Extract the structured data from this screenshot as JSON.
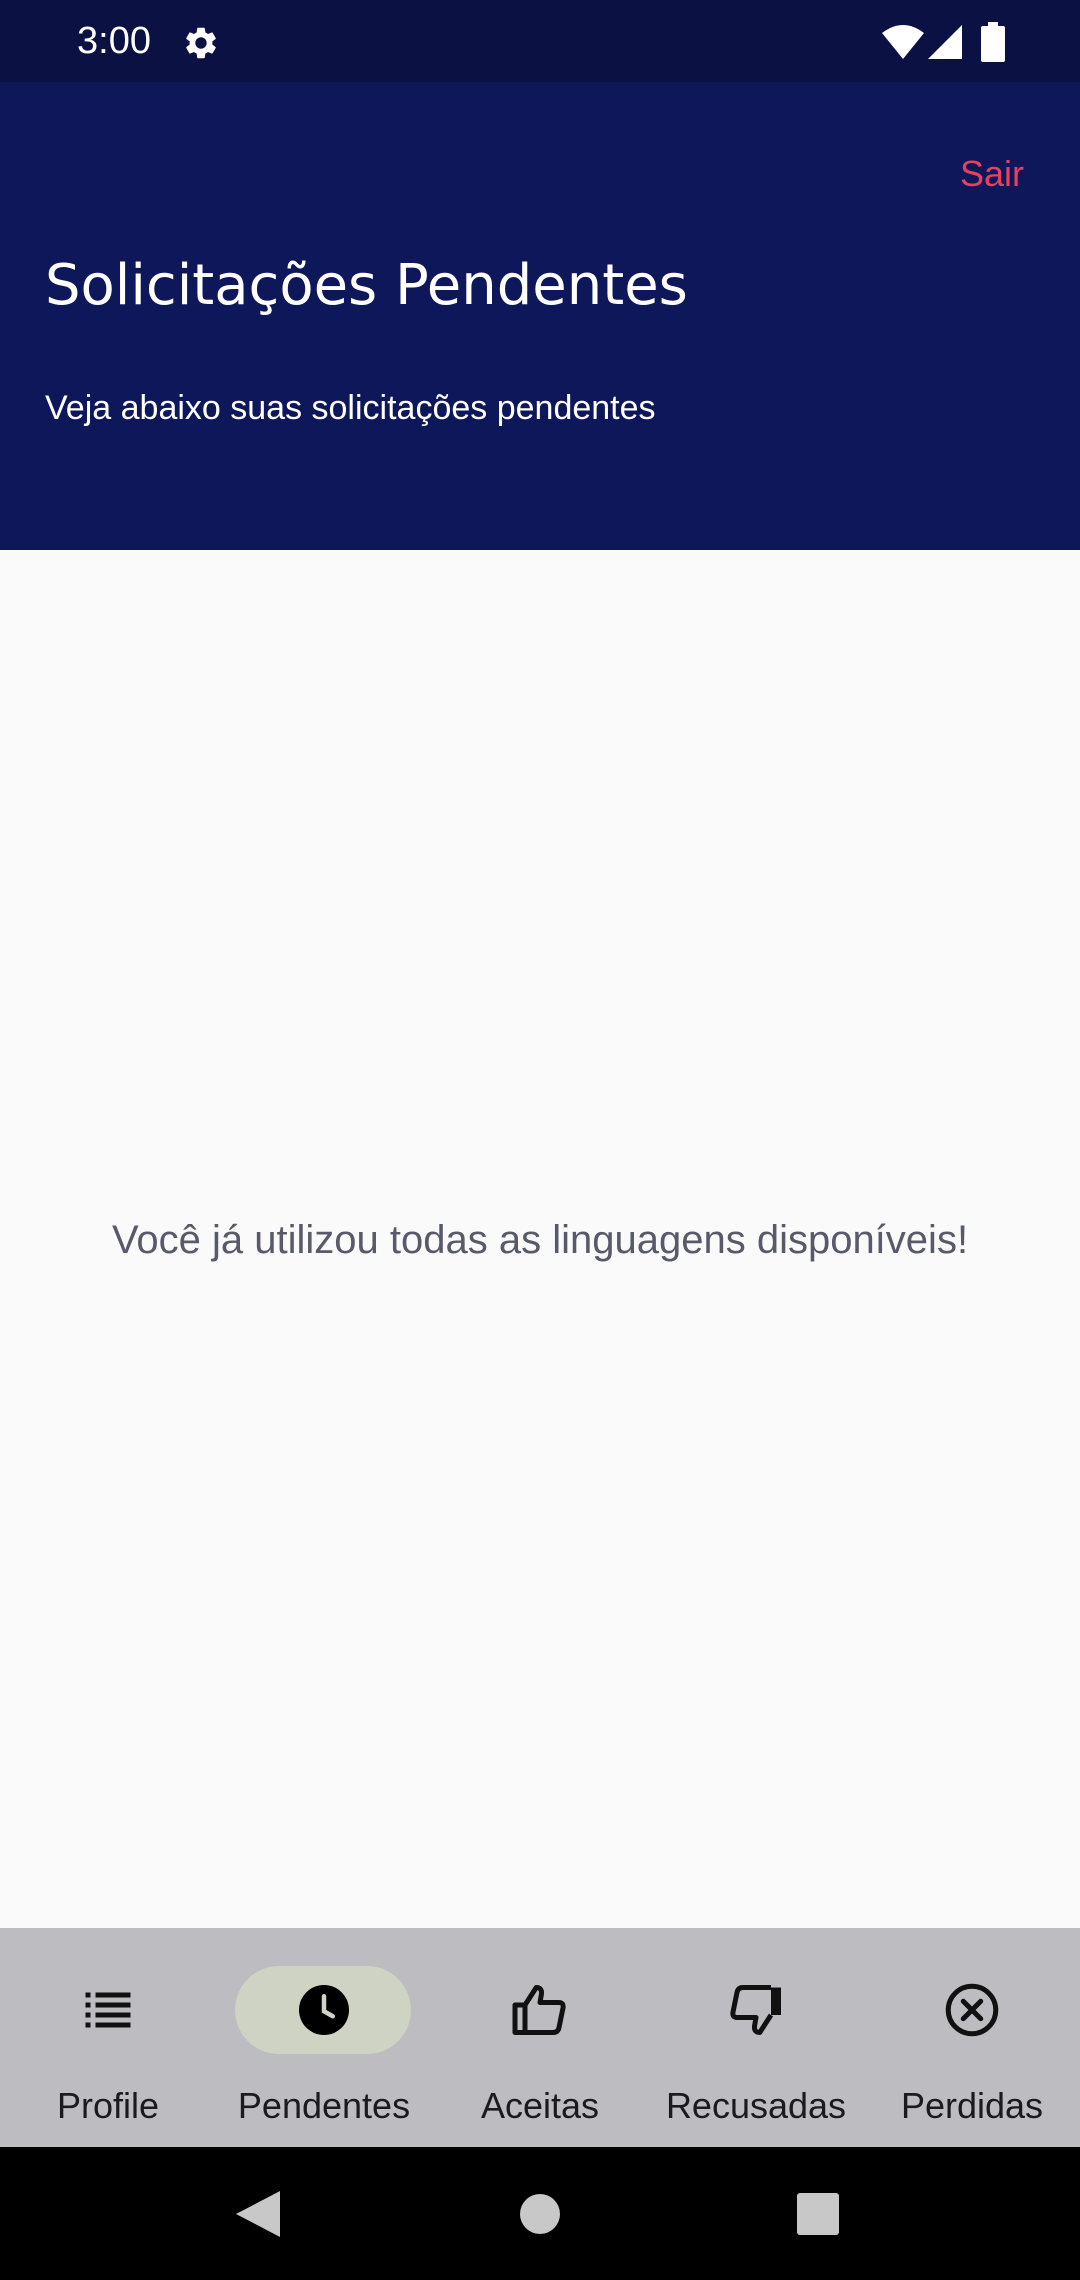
{
  "status_bar": {
    "time": "3:00",
    "icons": [
      "gear-icon",
      "wifi-icon",
      "signal-icon",
      "battery-icon"
    ]
  },
  "header": {
    "logout_label": "Sair",
    "title": "Solicitações Pendentes",
    "subtitle": "Veja abaixo suas solicitações pendentes"
  },
  "main": {
    "empty_message": "Você já utilizou todas as linguagens disponíveis!"
  },
  "bottom_nav": {
    "active_index": 1,
    "items": [
      {
        "label": "Profile",
        "icon": "list-icon"
      },
      {
        "label": "Pendentes",
        "icon": "clock-icon"
      },
      {
        "label": "Aceitas",
        "icon": "thumbs-up-icon"
      },
      {
        "label": "Recusadas",
        "icon": "thumbs-down-icon"
      },
      {
        "label": "Perdidas",
        "icon": "cancel-circle-icon"
      }
    ]
  },
  "system_nav": {
    "icons": [
      "back-icon",
      "home-icon",
      "recents-icon"
    ]
  },
  "colors": {
    "status_bar": "#0b1243",
    "header": "#0f175b",
    "logout": "#e8405e",
    "background": "#fafafa",
    "bottom_nav": "#bdbcc1",
    "active_indicator": "#cfd3c4",
    "empty_text": "#585a6a"
  }
}
